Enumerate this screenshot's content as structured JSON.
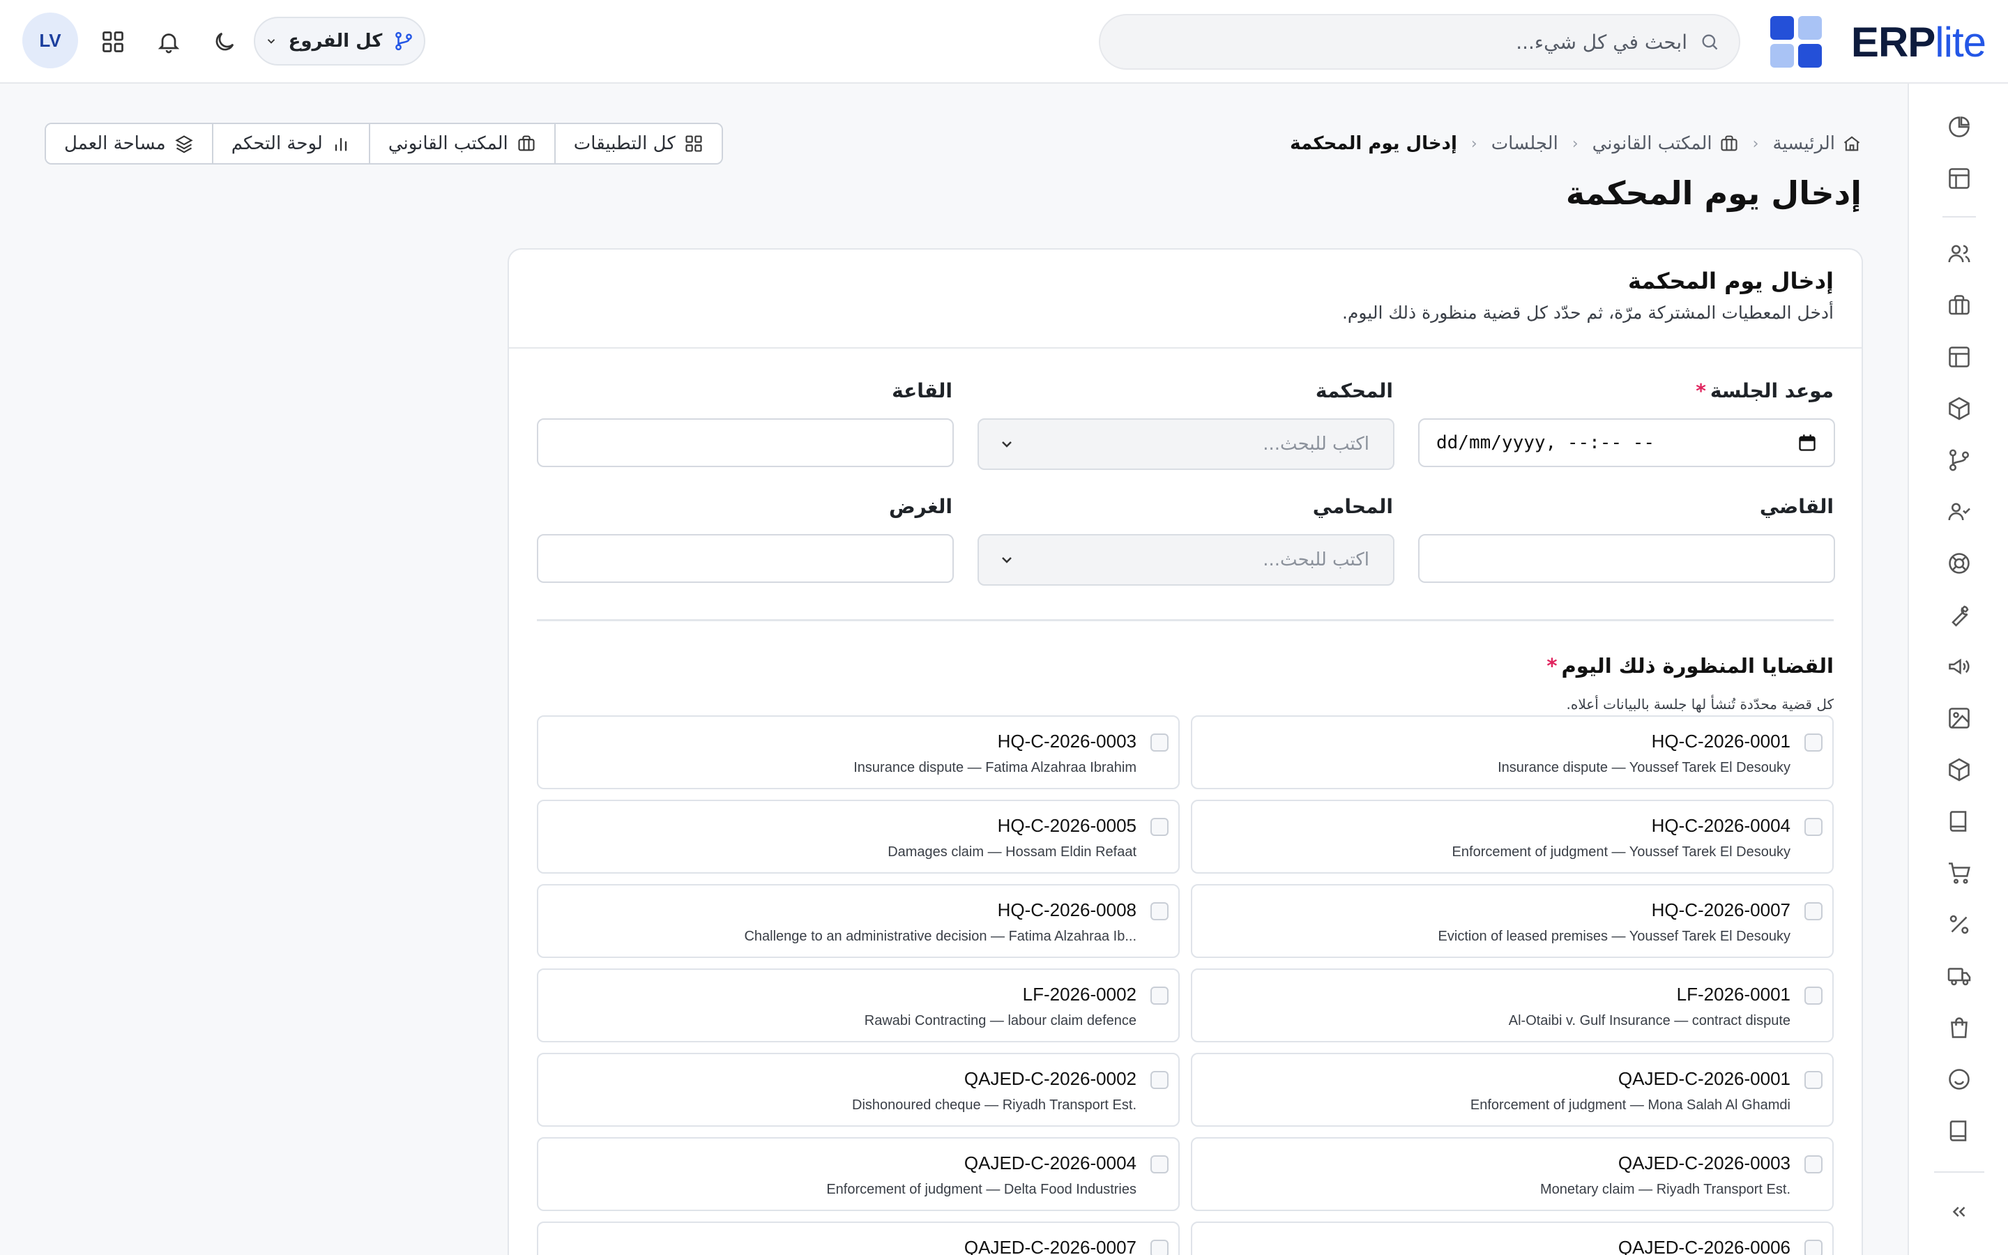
{
  "header": {
    "logo": {
      "erp": "ERP",
      "lite": "lite"
    },
    "search_placeholder": "ابحث في كل شيء...",
    "branch_label": "كل الفروع",
    "avatar_initials": "LV"
  },
  "breadcrumb": {
    "home": "الرئيسية",
    "legal_office": "المكتب القانوني",
    "sessions": "الجلسات",
    "current": "إدخال يوم المحكمة"
  },
  "quickbar": {
    "all_apps": "كل التطبيقات",
    "legal_office": "المكتب القانوني",
    "dashboard": "لوحة التحكم",
    "workspace": "مساحة العمل"
  },
  "page_title": "إدخال يوم المحكمة",
  "card": {
    "title": "إدخال يوم المحكمة",
    "subtitle": "أدخل المعطيات المشتركة مرّة، ثم حدّد كل قضية منظورة ذلك اليوم."
  },
  "form": {
    "session_time": {
      "label": "موعد الجلسة",
      "required": "*",
      "value": "dd/mm/yyyy, --:-- --"
    },
    "court": {
      "label": "المحكمة",
      "placeholder": "اكتب للبحث..."
    },
    "hall": {
      "label": "القاعة",
      "value": ""
    },
    "judge": {
      "label": "القاضي",
      "value": ""
    },
    "lawyer": {
      "label": "المحامي",
      "placeholder": "اكتب للبحث..."
    },
    "purpose": {
      "label": "الغرض",
      "value": ""
    }
  },
  "cases": {
    "title": "القضايا المنظورة ذلك اليوم",
    "required": "*",
    "hint": "كل قضية محدّدة تُنشأ لها جلسة بالبيانات أعلاه.",
    "items": [
      {
        "code": "HQ-C-2026-0001",
        "desc": "Insurance dispute — Youssef Tarek El Desouky"
      },
      {
        "code": "HQ-C-2026-0003",
        "desc": "Insurance dispute — Fatima Alzahraa Ibrahim"
      },
      {
        "code": "HQ-C-2026-0004",
        "desc": "Enforcement of judgment — Youssef Tarek El Desouky"
      },
      {
        "code": "HQ-C-2026-0005",
        "desc": "Damages claim — Hossam Eldin Refaat"
      },
      {
        "code": "HQ-C-2026-0007",
        "desc": "Eviction of leased premises — Youssef Tarek El Desouky"
      },
      {
        "code": "HQ-C-2026-0008",
        "desc": "Challenge to an administrative decision — Fatima Alzahraa Ib..."
      },
      {
        "code": "LF-2026-0001",
        "desc": "Al-Otaibi v. Gulf Insurance — contract dispute"
      },
      {
        "code": "LF-2026-0002",
        "desc": "Rawabi Contracting — labour claim defence"
      },
      {
        "code": "QAJED-C-2026-0001",
        "desc": "Enforcement of judgment — Mona Salah Al Ghamdi"
      },
      {
        "code": "QAJED-C-2026-0002",
        "desc": "Dishonoured cheque — Riyadh Transport Est."
      },
      {
        "code": "QAJED-C-2026-0003",
        "desc": "Monetary claim — Riyadh Transport Est."
      },
      {
        "code": "QAJED-C-2026-0004",
        "desc": "Enforcement of judgment — Delta Food Industries"
      },
      {
        "code": "QAJED-C-2026-0006",
        "desc": ""
      },
      {
        "code": "QAJED-C-2026-0007",
        "desc": ""
      }
    ]
  },
  "rail_icons": [
    "pie-chart-icon",
    "layout-icon",
    "users-icon",
    "briefcase-icon",
    "layout-icon",
    "cube-icon",
    "branch-icon",
    "user-check-icon",
    "lifebuoy-icon",
    "wrench-icon",
    "megaphone-icon",
    "image-icon",
    "box-icon",
    "book-icon",
    "cart-icon",
    "percent-icon",
    "truck-icon",
    "shopping-bag-icon",
    "smile-icon",
    "book-icon",
    "collapse-icon"
  ],
  "colors": {
    "accent": "#2457e6",
    "brand_dark": "#0d1b3d",
    "required": "#e0245e"
  }
}
